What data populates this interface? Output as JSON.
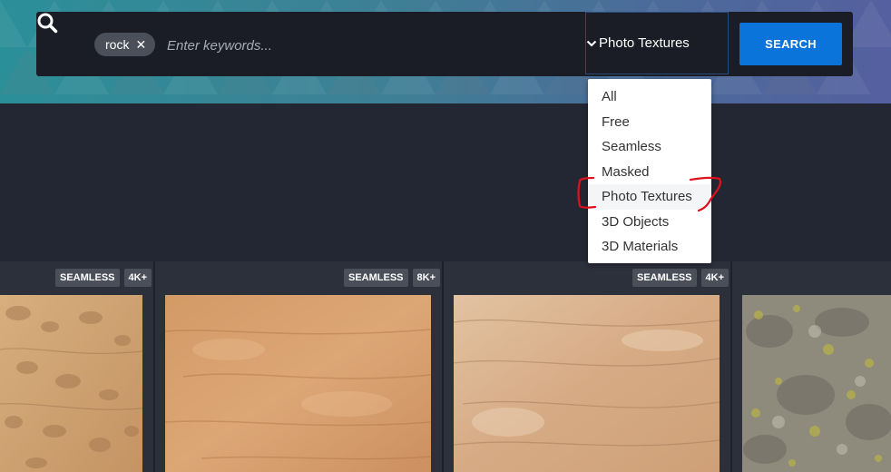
{
  "search": {
    "tag": "rock",
    "placeholder": "Enter keywords...",
    "category_selected": "Photo Textures",
    "button_label": "SEARCH"
  },
  "dropdown": {
    "options": [
      "All",
      "Free",
      "Seamless",
      "Masked",
      "Photo Textures",
      "3D Objects",
      "3D Materials"
    ],
    "highlighted": "Photo Textures"
  },
  "cards": [
    {
      "badges": [
        "SEAMLESS",
        "4K+"
      ]
    },
    {
      "badges": [
        "SEAMLESS",
        "8K+"
      ]
    },
    {
      "badges": [
        "SEAMLESS",
        "4K+"
      ]
    },
    {
      "badges": []
    }
  ],
  "colors": {
    "accent": "#0a74da",
    "annotation": "#e0101c",
    "page_bg": "#232733"
  }
}
